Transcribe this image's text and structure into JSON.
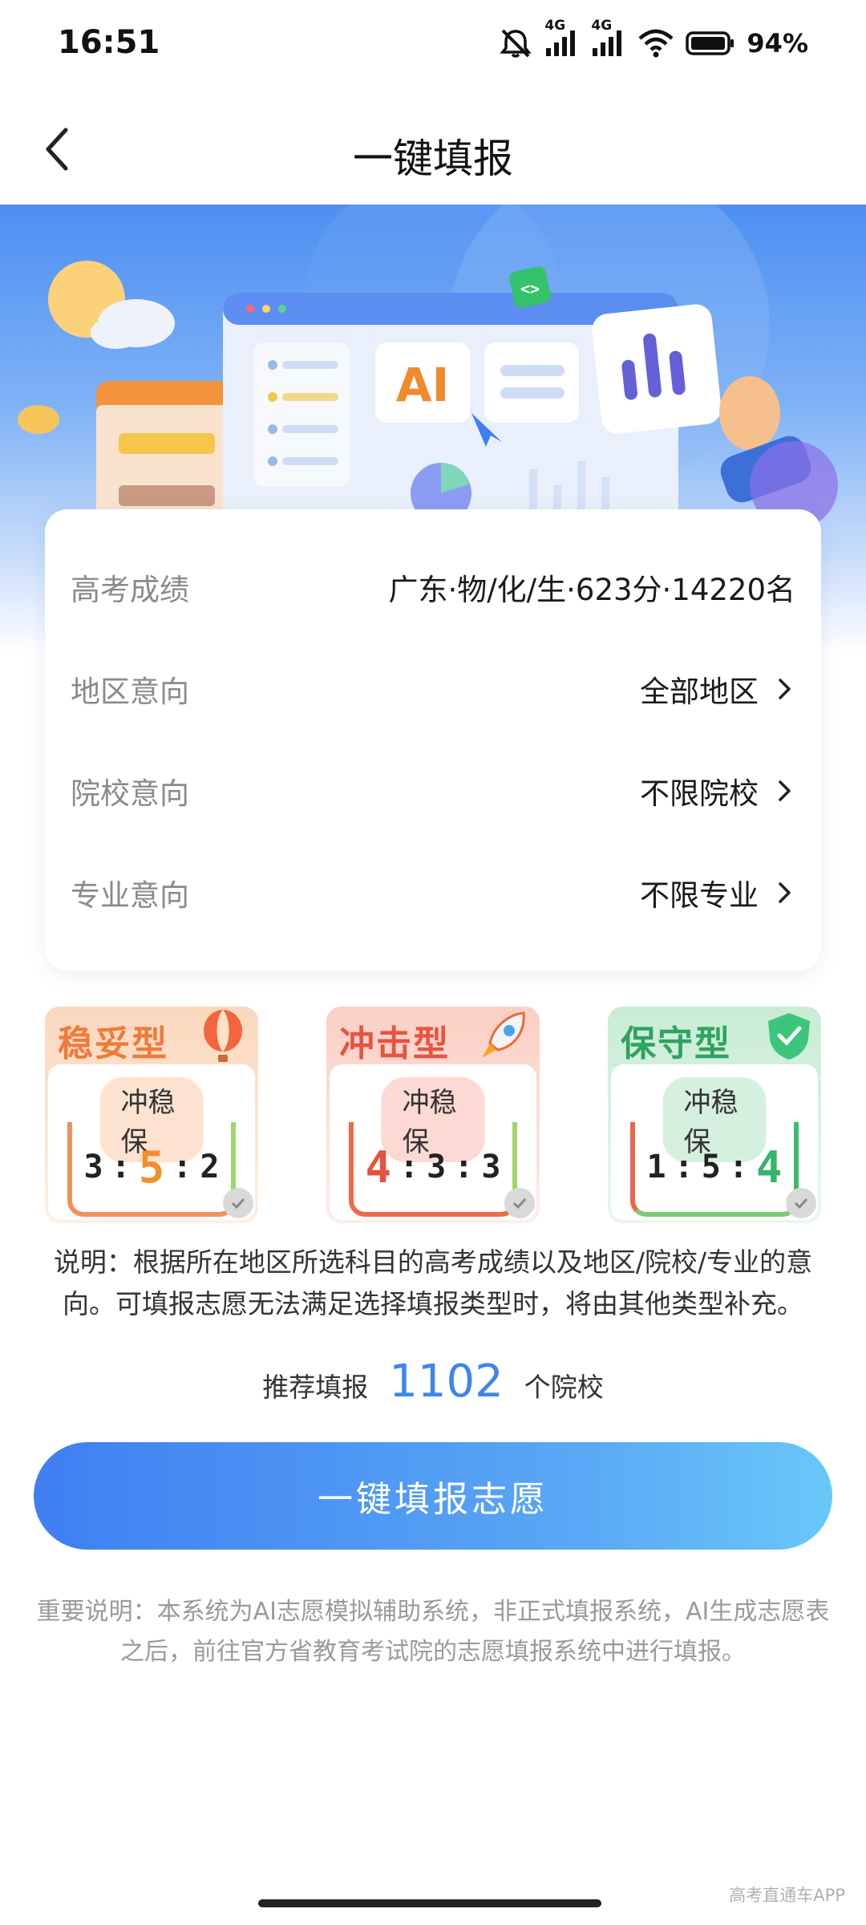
{
  "status_bar": {
    "time": "16:51",
    "network_1": "4G",
    "network_2": "4G",
    "battery": "94%",
    "icons": [
      "mute-bell-icon",
      "signal-icon",
      "signal-icon",
      "wifi-icon",
      "battery-icon"
    ]
  },
  "nav": {
    "title": "一键填报",
    "back_icon": "chevron-left-icon"
  },
  "hero": {
    "ai_label": "AI",
    "code_badge": "<>"
  },
  "info": {
    "score": {
      "label": "高考成绩",
      "value": "广东·物/化/生·623分·14220名"
    },
    "region": {
      "label": "地区意向",
      "value": "全部地区"
    },
    "school": {
      "label": "院校意向",
      "value": "不限院校"
    },
    "major": {
      "label": "专业意向",
      "value": "不限专业"
    }
  },
  "types": [
    {
      "title": "稳妥型",
      "pill": "冲稳保",
      "r1": "3",
      "sep1": ":",
      "r2": "5",
      "sep2": ":",
      "r3": "2",
      "color": "#f07a3c",
      "accent": "#fde3cf",
      "selected": false
    },
    {
      "title": "冲击型",
      "pill": "冲稳保",
      "r1": "4",
      "sep1": ":",
      "r2": "3",
      "sep2": ":",
      "r3": "3",
      "color": "#e8533f",
      "accent": "#fcd9d2",
      "selected": false
    },
    {
      "title": "保守型",
      "pill": "冲稳保",
      "r1": "1",
      "sep1": ":",
      "r2": "5",
      "sep2": ":",
      "r3": "4",
      "color": "#37b46c",
      "accent": "#d6f0df",
      "selected": false
    }
  ],
  "description": "说明：根据所在地区所选科目的高考成绩以及地区/院校/专业的意向。可填报志愿无法满足选择填报类型时，将由其他类型补充。",
  "recommend": {
    "prefix": "推荐填报",
    "count": "1102",
    "suffix": "个院校"
  },
  "main_button": "一键填报志愿",
  "notice": "重要说明：本系统为AI志愿模拟辅助系统，非正式填报系统，AI生成志愿表之后，前往官方省教育考试院的志愿填报系统中进行填报。",
  "watermark": "高考直通车APP",
  "colors": {
    "primary": "#3f84f0",
    "steady": "#f07a3c",
    "rush": "#e8533f",
    "safe": "#37b46c"
  }
}
